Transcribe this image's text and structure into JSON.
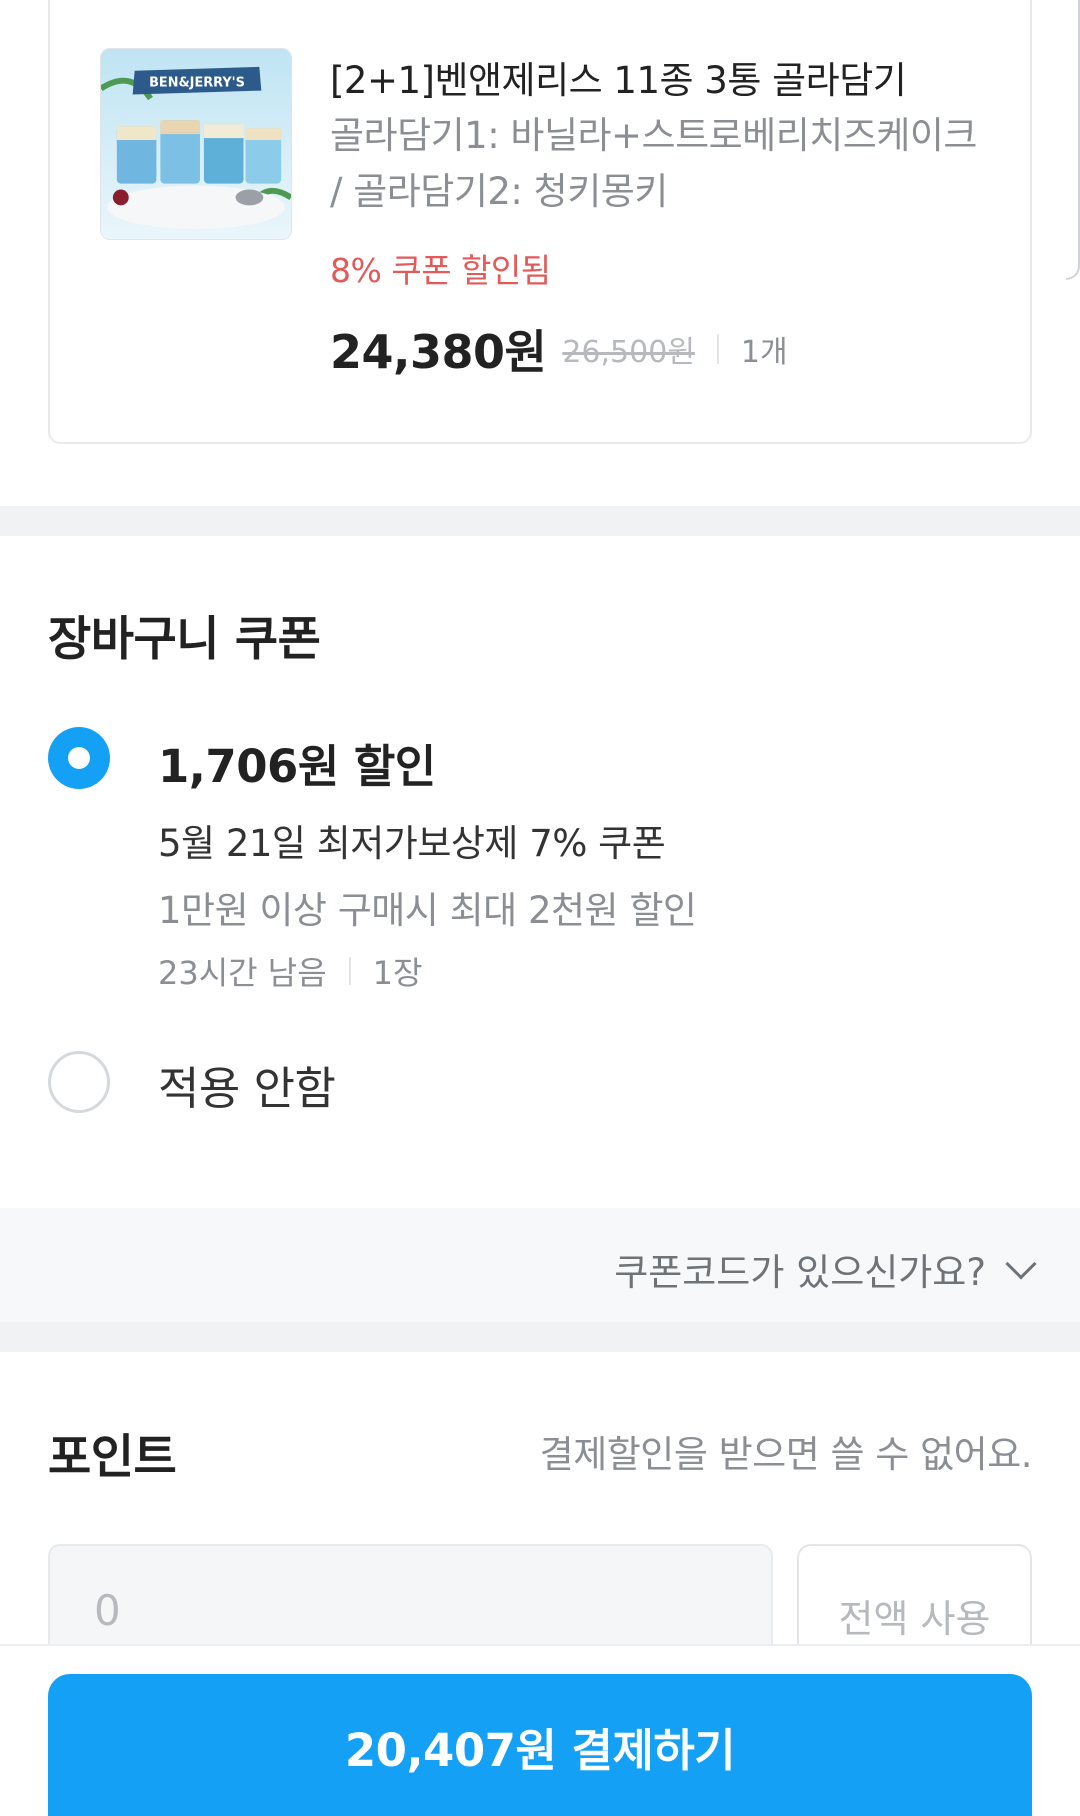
{
  "product": {
    "name": "[2+1]벤앤제리스 11종 3통 골라담기",
    "option": "골라담기1: 바닐라+스트로베리치즈케이크 / 골라담기2: 청키몽키",
    "coupon_note": "8% 쿠폰 할인됨",
    "price": "24,380원",
    "original_price": "26,500원",
    "quantity": "1개",
    "image_brand": "BEN&JERRY'S"
  },
  "cart_coupon": {
    "title": "장바구니 쿠폰",
    "options": [
      {
        "amount": "1,706원 할인",
        "name": "5월 21일 최저가보상제 7% 쿠폰",
        "condition": "1만원 이상 구매시 최대 2천원 할인",
        "time_left": "23시간 남음",
        "count": "1장",
        "selected": true
      },
      {
        "label": "적용 안함",
        "selected": false
      }
    ],
    "code_prompt": "쿠폰코드가 있으신가요?"
  },
  "points": {
    "title": "포인트",
    "note": "결제할인을 받으면 쓸 수 없어요.",
    "input_value": "0",
    "use_all_label": "전액 사용"
  },
  "checkout": {
    "button_label": "20,407원 결제하기"
  },
  "colors": {
    "accent": "#13a0f5",
    "discount_red": "#e25a5a",
    "muted_text": "#8b8f94"
  }
}
